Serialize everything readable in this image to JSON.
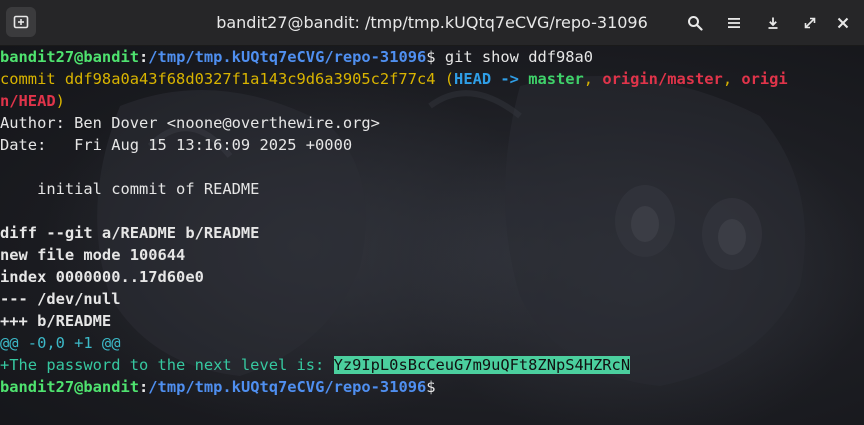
{
  "window": {
    "title": "bandit27@bandit: /tmp/tmp.kUQtq7eCVG/repo-31096"
  },
  "icons": {
    "new_tab": "new-tab-icon",
    "search": "search-icon",
    "menu": "hamburger-menu-icon",
    "minimize": "minimize-icon",
    "maximize": "maximize-icon",
    "close": "close-icon"
  },
  "colors": {
    "prompt_user": "#4fe36f",
    "prompt_path": "#4f8ff0",
    "commit_hash": "#d9b400",
    "head_ref": "#2f9ee6",
    "branch_local": "#3fd26a",
    "branch_remote": "#e0344a",
    "hunk_header": "#3cb9c8",
    "added_line": "#36c8a0",
    "highlight_bg": "#4bcf9e"
  },
  "terminal": {
    "prompt1": {
      "user": "bandit27@bandit",
      "sep": ":",
      "path": "/tmp/tmp.kUQtq7eCVG/repo-31096",
      "dollar": "$",
      "command": " git show ddf98a0"
    },
    "commit_line": {
      "prefix": "commit ddf98a0a43f68d0327f1a143c9d6a3905c2f77c4 ",
      "open": "(",
      "head": "HEAD -> ",
      "master": "master",
      "comma1": ", ",
      "origin_master": "origin/master",
      "comma2": ", ",
      "origin_head_start": "origi"
    },
    "commit_line_wrap": {
      "origin_head_end": "n/HEAD",
      "close": ")"
    },
    "author": "Author: Ben Dover <noone@overthewire.org>",
    "date": "Date:   Fri Aug 15 13:16:09 2025 +0000",
    "blank1": "",
    "message": "    initial commit of README",
    "blank2": "",
    "diff_header": "diff --git a/README b/README",
    "new_file_mode": "new file mode 100644",
    "index": "index 0000000..17d60e0",
    "minus_file": "--- /dev/null",
    "plus_file": "+++ b/README",
    "hunk": "@@ -0,0 +1 @@",
    "added": {
      "text": "+The password to the next level is: ",
      "password": "Yz9IpL0sBcCeuG7m9uQFt8ZNpS4HZRcN"
    },
    "prompt2": {
      "user": "bandit27@bandit",
      "sep": ":",
      "path": "/tmp/tmp.kUQtq7eCVG/repo-31096",
      "dollar": "$"
    }
  }
}
